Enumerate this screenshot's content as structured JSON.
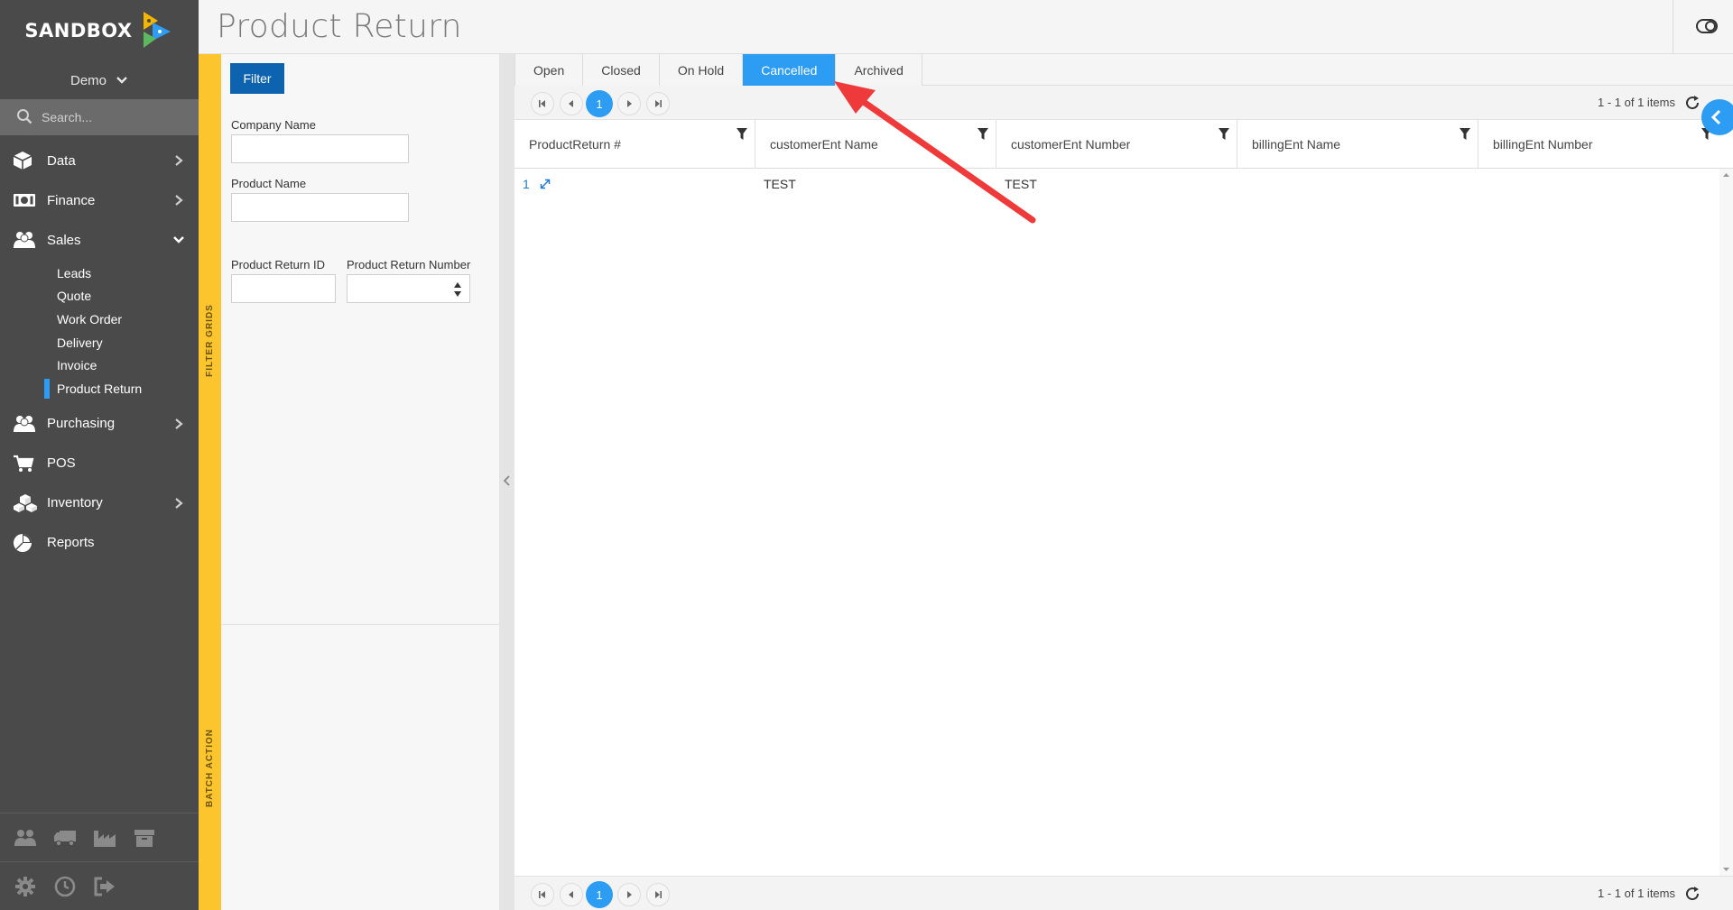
{
  "app": {
    "brand": "SANDBOX",
    "org": "Demo",
    "search_placeholder": "Search..."
  },
  "nav": {
    "items": [
      {
        "label": "Data",
        "icon": "cube-icon"
      },
      {
        "label": "Finance",
        "icon": "money-icon"
      },
      {
        "label": "Sales",
        "icon": "users-icon"
      }
    ],
    "sales_sub": [
      "Leads",
      "Quote",
      "Work Order",
      "Delivery",
      "Invoice",
      "Product Return"
    ],
    "items_after": [
      {
        "label": "Purchasing",
        "icon": "users-icon"
      },
      {
        "label": "POS",
        "icon": "cart-icon"
      },
      {
        "label": "Inventory",
        "icon": "boxes-icon"
      },
      {
        "label": "Reports",
        "icon": "pie-chart-icon"
      }
    ]
  },
  "header": {
    "title": "Product Return"
  },
  "side_tabs": {
    "filter": "FILTER GRIDS",
    "batch": "BATCH ACTION"
  },
  "filter": {
    "button": "Filter",
    "company_label": "Company Name",
    "company_value": "",
    "product_label": "Product Name",
    "product_value": "",
    "return_id_label": "Product Return ID",
    "return_id_value": "",
    "return_number_label": "Product Return Number",
    "return_number_value": ""
  },
  "tabs": [
    {
      "label": "Open",
      "active": false
    },
    {
      "label": "Closed",
      "active": false
    },
    {
      "label": "On Hold",
      "active": false
    },
    {
      "label": "Cancelled",
      "active": true
    },
    {
      "label": "Archived",
      "active": false
    }
  ],
  "pager": {
    "current_page": "1",
    "info": "1 - 1 of 1 items"
  },
  "grid": {
    "columns": [
      "ProductReturn #",
      "customerEnt Name",
      "customerEnt Number",
      "billingEnt Name",
      "billingEnt Number"
    ],
    "rows": [
      {
        "id": "1",
        "customer_name": "TEST",
        "customer_number": "TEST",
        "billing_name": "",
        "billing_number": ""
      }
    ]
  },
  "colors": {
    "sidebar": "#4a4a4a",
    "accent": "#2d9cf3",
    "filter_button": "#0e63b0",
    "side_tab": "#fcc52e",
    "annotation_arrow": "#ee3a3a"
  }
}
